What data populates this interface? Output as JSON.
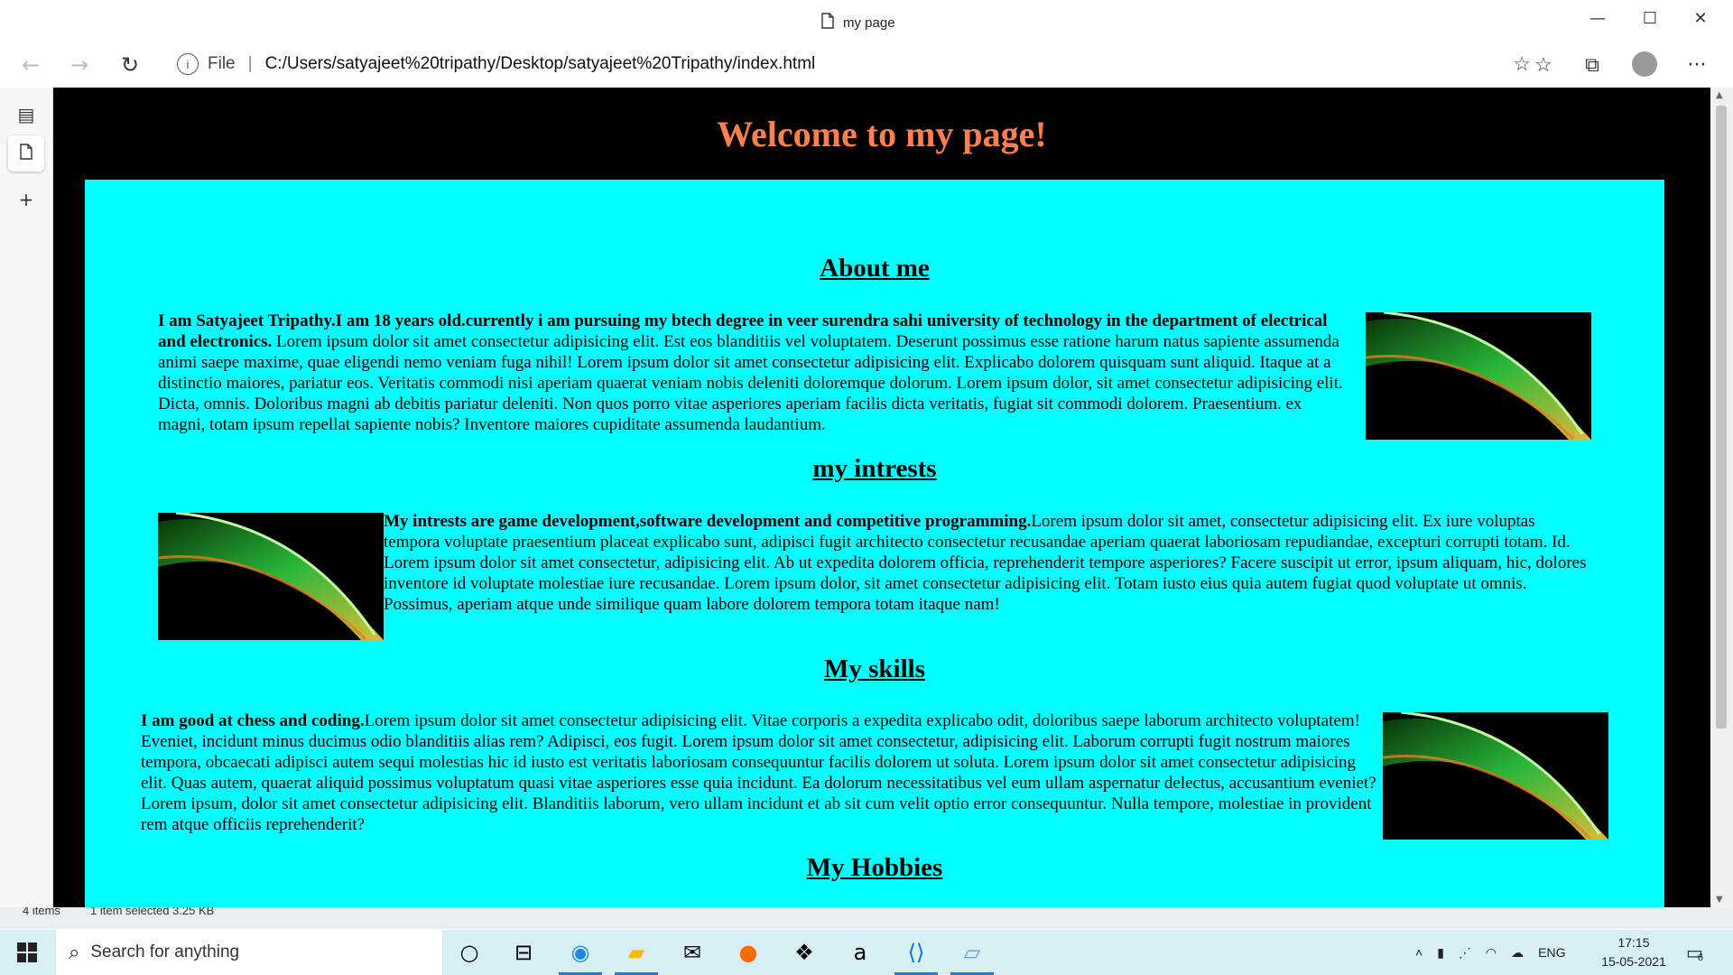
{
  "window": {
    "tab_title": "my page",
    "minimize": "—",
    "maximize": "☐",
    "close": "✕"
  },
  "toolbar": {
    "address_prefix": "File",
    "url": "C:/Users/satyajeet%20tripathy/Desktop/satyajeet%20Tripathy/index.html",
    "more": "···"
  },
  "page": {
    "title": "Welcome to my page!",
    "sections": [
      {
        "heading": "About me",
        "bold": "I am Satyajeet Tripathy.I am 18 years old.currently i am pursuing my btech degree in veer surendra sahi university of technology in the department of electrical and electronics.",
        "text": " Lorem ipsum dolor sit amet consectetur adipisicing elit. Est eos blanditiis vel voluptatem. Deserunt possimus esse ratione harum natus sapiente assumenda animi saepe maxime, quae eligendi nemo veniam fuga nihil! Lorem ipsum dolor sit amet consectetur adipisicing elit. Explicabo dolorem quisquam sunt aliquid. Itaque at a distinctio maiores, pariatur eos. Veritatis commodi nisi aperiam quaerat veniam nobis deleniti doloremque dolorum. Lorem ipsum dolor, sit amet consectetur adipisicing elit. Dicta, omnis. Doloribus magni ab debitis pariatur deleniti. Non quos porro vitae asperiores aperiam facilis dicta veritatis, fugiat sit commodi dolorem. Praesentium. ex magni, totam ipsum repellat sapiente nobis? Inventore maiores cupiditate assumenda laudantium."
      },
      {
        "heading": "my intrests",
        "bold": "My intrests are game development,software development and competitive programming.",
        "text": "Lorem ipsum dolor sit amet, consectetur adipisicing elit. Ex iure voluptas tempora voluptate praesentium placeat explicabo sunt, adipisci fugit architecto consectetur recusandae aperiam quaerat laboriosam repudiandae, excepturi corrupti totam. Id. Lorem ipsum dolor sit amet consectetur, adipisicing elit. Ab ut expedita dolorem officia, reprehenderit tempore asperiores? Facere suscipit ut error, ipsum aliquam, hic, dolores inventore id voluptate molestiae iure recusandae. Lorem ipsum dolor, sit amet consectetur adipisicing elit. Totam iusto eius quia autem fugiat quod voluptate ut omnis. Possimus, aperiam atque unde similique quam labore dolorem tempora totam itaque nam!"
      },
      {
        "heading": "My skills",
        "bold": "I am good at chess and coding.",
        "text": "Lorem ipsum dolor sit amet consectetur adipisicing elit. Vitae corporis a expedita explicabo odit, doloribus saepe laborum architecto voluptatem! Eveniet, incidunt minus ducimus odio blanditiis alias rem? Adipisci, eos fugit. Lorem ipsum dolor sit amet consectetur, adipisicing elit. Laborum corrupti fugit nostrum maiores tempora, obcaecati adipisci autem sequi molestias hic id iusto est veritatis laboriosam consequuntur facilis dolorem ut soluta. Lorem ipsum dolor sit amet consectetur adipisicing elit. Quas autem, quaerat aliquid possimus voluptatum quasi vitae asperiores esse quia incidunt. Ea dolorum necessitatibus vel eum ullam aspernatur delectus, accusantium eveniet? Lorem ipsum, dolor sit amet consectetur adipisicing elit. Blanditiis laborum, vero ullam incidunt et ab sit cum velit optio error consequuntur. Nulla tempore, molestiae in provident rem atque officiis reprehenderit?"
      },
      {
        "heading": "My Hobbies"
      }
    ]
  },
  "statusbar": {
    "items": "4 items",
    "selected": "1 item selected  3.25 KB"
  },
  "taskbar": {
    "search_placeholder": "Search for anything",
    "language": "ENG",
    "time": "17:15",
    "date": "15-05-2021",
    "notification_count": "6"
  }
}
